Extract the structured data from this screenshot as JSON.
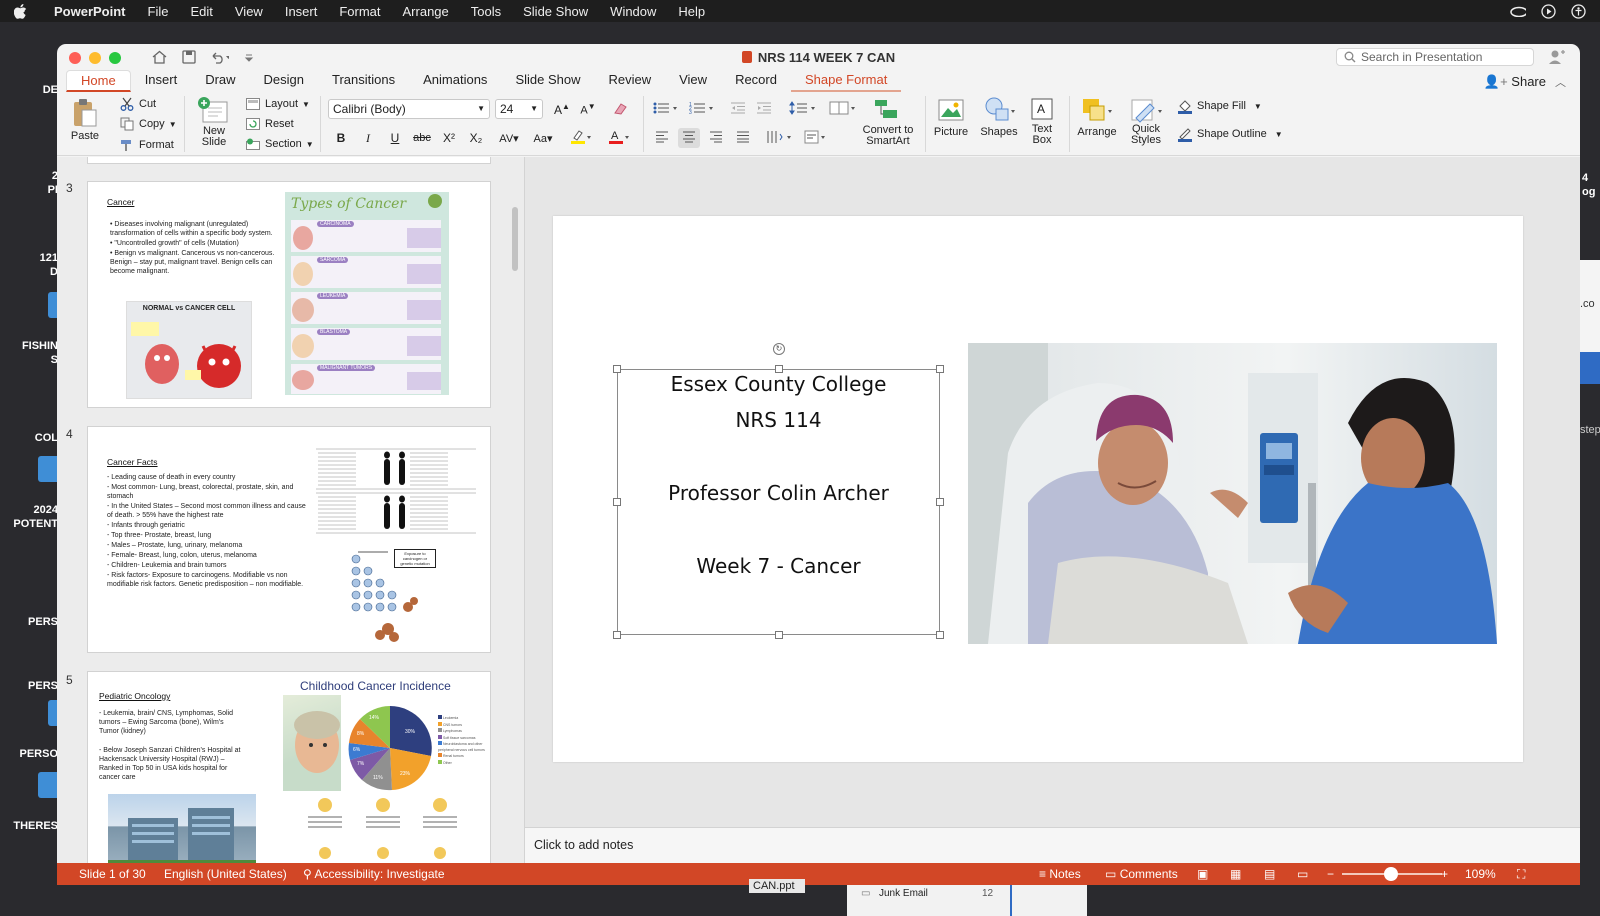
{
  "menubar": {
    "app": "PowerPoint",
    "items": [
      "File",
      "Edit",
      "View",
      "Insert",
      "Format",
      "Arrange",
      "Tools",
      "Slide Show",
      "Window",
      "Help"
    ]
  },
  "desktop": {
    "labels": [
      "DE",
      "2",
      "PI",
      "121",
      "D",
      "FISHIN",
      "S",
      "COL",
      "2024",
      "POTENT",
      "PERS",
      "PERS",
      "PERSO",
      "THERES",
      ".co",
      "step",
      "4",
      "og"
    ]
  },
  "window": {
    "title": "NRS 114 WEEK 7 CAN",
    "search_placeholder": "Search in Presentation",
    "share_label": "Share",
    "tabs": [
      "Home",
      "Insert",
      "Draw",
      "Design",
      "Transitions",
      "Animations",
      "Slide Show",
      "Review",
      "View",
      "Record",
      "Shape Format"
    ]
  },
  "ribbon": {
    "paste": "Paste",
    "cut": "Cut",
    "copy": "Copy",
    "format": "Format",
    "new_slide": "New Slide",
    "layout": "Layout",
    "reset": "Reset",
    "section": "Section",
    "font_name": "Calibri (Body)",
    "font_size": "24",
    "bold": "B",
    "italic": "I",
    "underline": "U",
    "strike": "abc",
    "superscript": "X²",
    "subscript": "X₂",
    "convert_smartart": "Convert to SmartArt",
    "picture": "Picture",
    "shapes": "Shapes",
    "text_box": "Text Box",
    "arrange": "Arrange",
    "quick_styles": "Quick Styles",
    "shape_fill": "Shape Fill",
    "shape_outline": "Shape Outline"
  },
  "thumbnails": [
    {
      "number": "3",
      "title": "Cancer",
      "bullets": [
        "Diseases involving malignant (unregulated) transformation of cells within a specific body system.",
        "\"Uncontrolled growth\" of cells (Mutation)",
        "Benign vs malignant. Cancerous vs non-cancerous. Benign – stay put, malignant travel. Benign cells can become malignant."
      ],
      "image_caption": "NORMAL vs CANCER CELL",
      "infographic_title": "Types of Cancer",
      "types": [
        "CARCINOMA",
        "SARCOMA",
        "LEUKEMIA",
        "BLASTOMA",
        "MALIGNANT TUMORS"
      ]
    },
    {
      "number": "4",
      "title": "Cancer Facts",
      "lines": [
        "- Leading cause of death in every country",
        "- Most common- Lung, breast, colorectal, prostate, skin, and stomach",
        "- In the United States – Second most common illness and cause of death. > 55% have the highest rate",
        "- Infants through geriatric",
        "- Top three- Prostate, breast, lung",
        "- Males – Prostate, lung, urinary, melanoma",
        "- Female- Breast, lung, colon, uterus, melanoma",
        "- Children- Leukemia and brain tumors",
        "- Risk factors- Exposure to carcinogens. Modifiable vs non modifiable risk factors. Genetic predisposition – non modifiable."
      ],
      "diagram_label": "Exposure to carcinogen or genetic mutation"
    },
    {
      "number": "5",
      "title": "Pediatric Oncology",
      "lines": [
        "- Leukemia, brain/ CNS, Lymphomas, Solid tumors – Ewing Sarcoma (bone), Wilm's Tumor (kidney)",
        "- Below Joseph Sanzari Children's Hospital at Hackensack University Hospital (RWJ) – Ranked in Top 50 in USA kids hospital for cancer care"
      ],
      "chart_title": "Childhood Cancer Incidence",
      "pie_labels": [
        "30%",
        "23%",
        "11%",
        "7%",
        "6%",
        "8%",
        "14%"
      ],
      "legend": [
        "Leukemia",
        "CNS tumors",
        "Lymphomas",
        "Soft tissue sarcomas",
        "Neuroblastoma and other peripheral nervous cell tumors",
        "Renal tumors",
        "Other"
      ]
    }
  ],
  "slide": {
    "lines": [
      "Essex County College",
      "NRS 114",
      "Professor Colin Archer",
      "Week 7 - Cancer"
    ]
  },
  "notes_placeholder": "Click to add notes",
  "status": {
    "slide_of": "Slide 1 of 30",
    "language": "English (United States)",
    "accessibility": "Accessibility: Investigate",
    "notes": "Notes",
    "comments": "Comments",
    "zoom": "109%"
  },
  "underlay": {
    "file": "CAN.ppt",
    "folder": "Junk Email",
    "count": "12"
  },
  "colors": {
    "accent": "#d24726",
    "menubar": "#1e1e1e"
  }
}
